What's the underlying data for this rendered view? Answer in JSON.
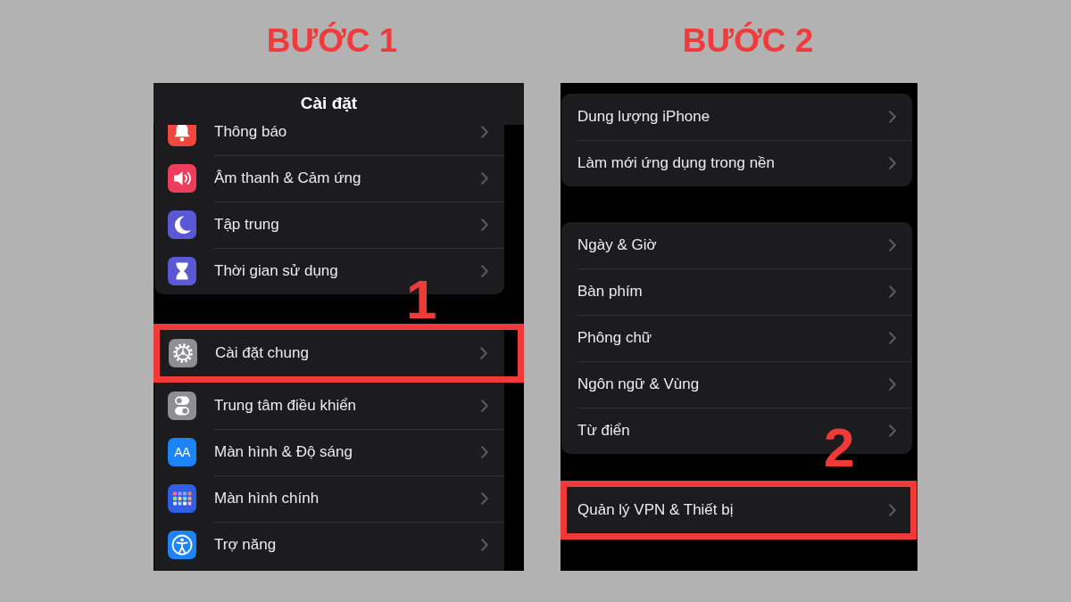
{
  "steps": [
    {
      "title": "BƯỚC 1",
      "callout": "1",
      "screen": {
        "header": "Cài đặt",
        "groups": [
          {
            "rows": [
              {
                "label": "Thông báo",
                "color": "#f0483e",
                "highlighted": false
              },
              {
                "label": "Âm thanh & Cảm ứng",
                "color": "#ee3d5c",
                "highlighted": false
              },
              {
                "label": "Tập trung",
                "color": "#5b58d6",
                "highlighted": false
              },
              {
                "label": "Thời gian sử dụng",
                "color": "#5b58d6",
                "highlighted": false
              }
            ]
          },
          {
            "rows": [
              {
                "label": "Cài đặt chung",
                "color": "#8e8e93",
                "highlighted": true
              },
              {
                "label": "Trung tâm điều khiển",
                "color": "#8e8e93",
                "highlighted": false
              },
              {
                "label": "Màn hình & Độ sáng",
                "color": "#1c84f6",
                "icon_text": "AA",
                "highlighted": false
              },
              {
                "label": "Màn hình chính",
                "color": "#2e5fe6",
                "highlighted": false
              },
              {
                "label": "Trợ năng",
                "color": "#1c84f6",
                "highlighted": false
              }
            ]
          }
        ]
      }
    },
    {
      "title": "BƯỚC 2",
      "callout": "2",
      "screen": {
        "groups": [
          {
            "rows": [
              {
                "label": "Dung lượng iPhone",
                "highlighted": false
              },
              {
                "label": "Làm mới ứng dụng trong nền",
                "highlighted": false
              }
            ]
          },
          {
            "rows": [
              {
                "label": "Ngày & Giờ",
                "highlighted": false
              },
              {
                "label": "Bàn phím",
                "highlighted": false
              },
              {
                "label": "Phông chữ",
                "highlighted": false
              },
              {
                "label": "Ngôn ngữ & Vùng",
                "highlighted": false
              },
              {
                "label": "Từ điển",
                "highlighted": false
              }
            ]
          },
          {
            "rows": [
              {
                "label": "Quản lý VPN & Thiết bị",
                "highlighted": true
              }
            ]
          }
        ]
      }
    }
  ]
}
